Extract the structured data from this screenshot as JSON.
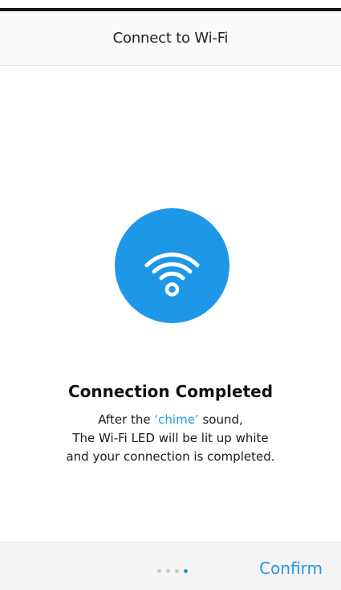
{
  "header": {
    "title": "Connect to Wi-Fi"
  },
  "status": {
    "icon": "wifi-icon",
    "title": "Connection Completed",
    "desc_line1_before": "After the ",
    "desc_line1_highlight": "‘chime’",
    "desc_line1_after": " sound,",
    "desc_line2": "The Wi-Fi LED will be lit up white",
    "desc_line3": "and your connection is completed."
  },
  "footer": {
    "pager": {
      "total": 4,
      "current": 4
    },
    "confirm_label": "Confirm"
  },
  "colors": {
    "accent": "#1e98e6",
    "dot_inactive": "#cccccc"
  }
}
